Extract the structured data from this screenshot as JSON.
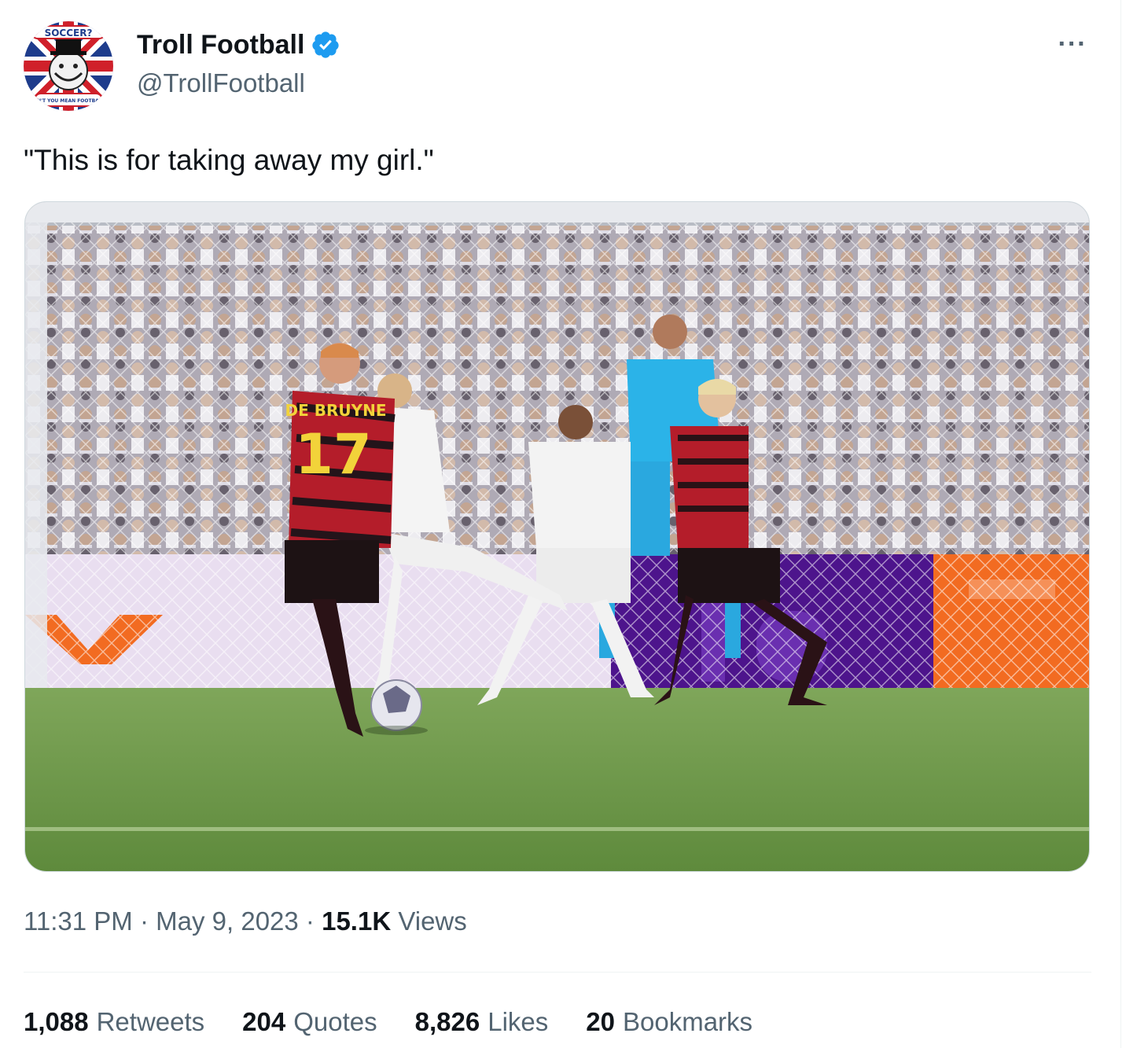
{
  "author": {
    "display_name": "Troll Football",
    "handle": "@TrollFootball",
    "verified": true,
    "avatar": {
      "top_text": "SOCCER?",
      "bottom_text": "DON'T YOU MEAN FOOTBALL?"
    }
  },
  "tweet": {
    "text": "\"This is for taking away my girl.\"",
    "more_label": "···"
  },
  "media": {
    "player_name": "DE BRUYNE",
    "player_number": "17"
  },
  "meta": {
    "time": "11:31 PM",
    "sep1": " · ",
    "date": "May 9, 2023",
    "sep2": " · ",
    "views_count": "15.1K",
    "views_label": "Views"
  },
  "stats": [
    {
      "count": "1,088",
      "label": "Retweets"
    },
    {
      "count": "204",
      "label": "Quotes"
    },
    {
      "count": "8,826",
      "label": "Likes"
    },
    {
      "count": "20",
      "label": "Bookmarks"
    }
  ],
  "colors": {
    "verified_blue": "#1d9bf0",
    "secondary_text": "#536471",
    "primary_text": "#0f1419",
    "divider": "#eff3f4"
  }
}
